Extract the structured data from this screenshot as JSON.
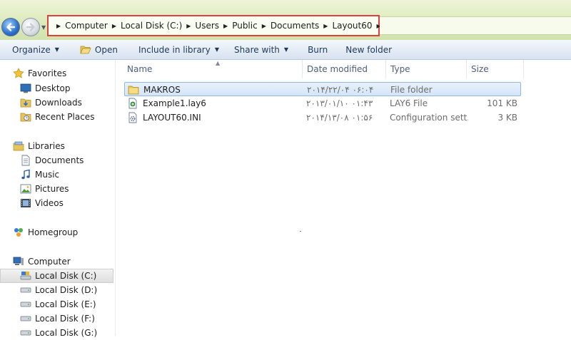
{
  "address_bar": {
    "breadcrumbs": [
      "Computer",
      "Local Disk (C:)",
      "Users",
      "Public",
      "Documents",
      "Layout60"
    ]
  },
  "toolbar": {
    "organize": "Organize",
    "open": "Open",
    "include_in_library": "Include in library",
    "share_with": "Share with",
    "burn": "Burn",
    "new_folder": "New folder"
  },
  "nav": {
    "favorites": {
      "label": "Favorites",
      "items": [
        "Desktop",
        "Downloads",
        "Recent Places"
      ]
    },
    "libraries": {
      "label": "Libraries",
      "items": [
        "Documents",
        "Music",
        "Pictures",
        "Videos"
      ]
    },
    "homegroup": "Homegroup",
    "computer": {
      "label": "Computer",
      "items": [
        "Local Disk (C:)",
        "Local Disk (D:)",
        "Local Disk (E:)",
        "Local Disk (F:)",
        "Local Disk (G:)"
      ],
      "selected_index": 0
    }
  },
  "columns": {
    "name": "Name",
    "date_modified": "Date modified",
    "type": "Type",
    "size": "Size"
  },
  "files": [
    {
      "name": "MAKROS",
      "date": "۲۰۱۴/۲۲/۰۴ ۰۶:۰۴",
      "type": "File folder",
      "size": "",
      "icon": "folder-icon",
      "selected": true
    },
    {
      "name": "Example1.lay6",
      "date": "۲۰۱۳/۰۱/۱۰ ۰۱:۴۳",
      "type": "LAY6 File",
      "size": "101 KB",
      "icon": "lay6-file-icon",
      "selected": false
    },
    {
      "name": "LAYOUT60.INI",
      "date": "۲۰۱۴/۱۳/۰۸ ۰۱:۵۶",
      "type": "Configuration sett...",
      "size": "3 KB",
      "icon": "settings-file-icon",
      "selected": false
    }
  ],
  "colors": {
    "highlight_box": "#e2403d",
    "selection": "#d4e5f8",
    "titlebar": "#dbe9b9"
  }
}
